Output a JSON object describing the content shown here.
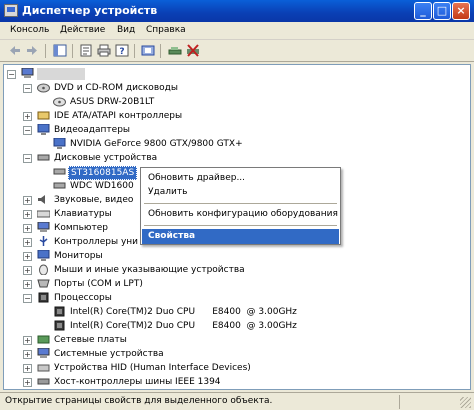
{
  "window": {
    "title": "Диспетчер устройств",
    "controls": {
      "minimize": "_",
      "maximize": "□",
      "close": "×"
    }
  },
  "menu": [
    "Консоль",
    "Действие",
    "Вид",
    "Справка"
  ],
  "toolbar": {
    "buttons": [
      "back-icon",
      "forward-icon",
      "show-hide-tree-icon",
      "properties-icon",
      "print-icon",
      "help-icon",
      "device-icon",
      "scan-hardware-icon",
      "uninstall-icon"
    ]
  },
  "tree": {
    "root": {
      "label": "",
      "expander": "−"
    },
    "items": [
      {
        "label": "DVD и CD-ROM дисководы",
        "expander": "−",
        "icon": "dvd-icon"
      },
      {
        "label": "ASUS DRW-20B1LT",
        "expander": "",
        "icon": "cdrom-device-icon"
      },
      {
        "label": "IDE ATA/ATAPI контроллеры",
        "expander": "+",
        "icon": "ide-controller-icon"
      },
      {
        "label": "Видеоадаптеры",
        "expander": "−",
        "icon": "display-adapter-icon"
      },
      {
        "label": "NVIDIA GeForce 9800 GTX/9800 GTX+",
        "expander": "",
        "icon": "video-card-icon"
      },
      {
        "label": "Дисковые устройства",
        "expander": "−",
        "icon": "disk-drives-icon"
      },
      {
        "label": "ST3160815AS",
        "expander": "",
        "icon": "hard-disk-icon"
      },
      {
        "label": "WDC WD1600",
        "expander": "",
        "icon": "hard-disk-icon"
      },
      {
        "label": "Звуковые, видео",
        "expander": "+",
        "icon": "sound-icon"
      },
      {
        "label": "Клавиатуры",
        "expander": "+",
        "icon": "keyboard-icon"
      },
      {
        "label": "Компьютер",
        "expander": "+",
        "icon": "computer-icon"
      },
      {
        "label": "Контроллеры уни",
        "expander": "+",
        "icon": "usb-controller-icon"
      },
      {
        "label": "Мониторы",
        "expander": "+",
        "icon": "monitor-icon"
      },
      {
        "label": "Мыши и иные указывающие устройства",
        "expander": "+",
        "icon": "mouse-icon"
      },
      {
        "label": "Порты (COM и LPT)",
        "expander": "+",
        "icon": "port-icon"
      },
      {
        "label": "Процессоры",
        "expander": "−",
        "icon": "processor-icon"
      },
      {
        "label": "Intel(R) Core(TM)2 Duo CPU      E8400  @ 3.00GHz",
        "expander": "",
        "icon": "cpu-icon"
      },
      {
        "label": "Intel(R) Core(TM)2 Duo CPU      E8400  @ 3.00GHz",
        "expander": "",
        "icon": "cpu-icon"
      },
      {
        "label": "Сетевые платы",
        "expander": "+",
        "icon": "network-card-icon"
      },
      {
        "label": "Системные устройства",
        "expander": "+",
        "icon": "system-devices-icon"
      },
      {
        "label": "Устройства HID (Human Interface Devices)",
        "expander": "+",
        "icon": "hid-icon"
      },
      {
        "label": "Хост-контроллеры шины IEEE 1394",
        "expander": "+",
        "icon": "ieee1394-icon"
      }
    ]
  },
  "context_menu": {
    "items": [
      "Обновить драйвер...",
      "Удалить",
      "Обновить конфигурацию оборудования",
      "Свойства"
    ]
  },
  "status": {
    "text": "Открытие страницы свойств для выделенного объекта."
  },
  "colors": {
    "selection": "#316ac5",
    "title_bar": "#0a3fb4",
    "chrome": "#ece9d8"
  }
}
